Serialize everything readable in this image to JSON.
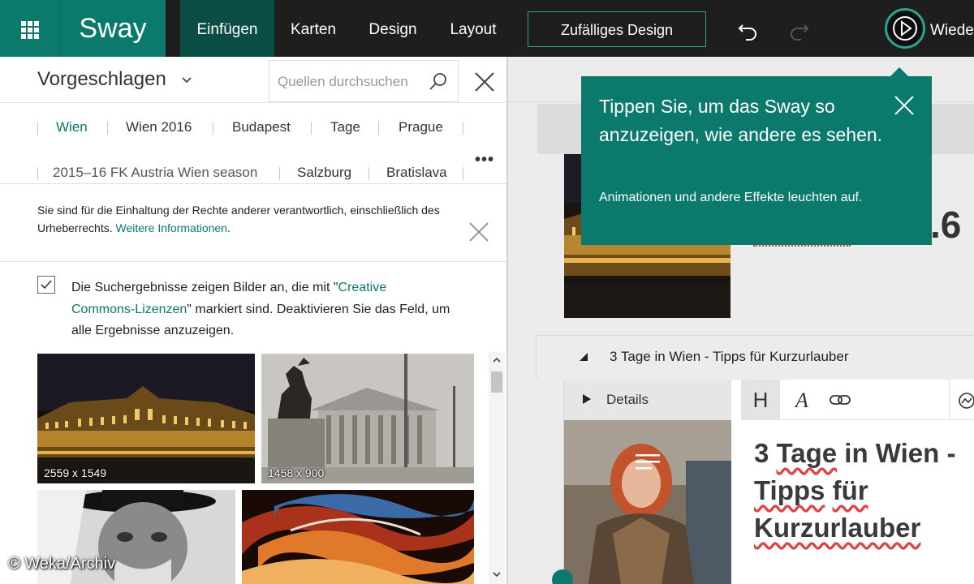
{
  "app": {
    "name": "Sway"
  },
  "colors": {
    "accent": "#0b7a6c",
    "topbar": "#1e1e1e",
    "active_tab": "#094d45",
    "link": "#0b7a6c",
    "spellcheck": "#dd4444"
  },
  "toolbar": {
    "tabs": [
      {
        "label": "Einfügen",
        "active": true
      },
      {
        "label": "Karten",
        "active": false
      },
      {
        "label": "Design",
        "active": false
      },
      {
        "label": "Layout",
        "active": false
      }
    ],
    "random_design_label": "Zufälliges Design",
    "undo_icon": "undo-icon",
    "redo_icon": "redo-icon",
    "play_icon": "play-icon",
    "replay_label": "Wiede"
  },
  "left_panel": {
    "source_label": "Vorgeschlagen",
    "search_placeholder": "Quellen durchsuchen",
    "chips_row1": [
      "Wien",
      "Wien 2016",
      "Budapest",
      "Tage",
      "Prague"
    ],
    "chips_row2": [
      "2015–16 FK Austria Wien season",
      "Salzburg",
      "Bratislava"
    ],
    "more_label": "•••",
    "rights_notice": {
      "text": "Sie sind für die Einhaltung der Rechte anderer verantwortlich, einschließlich des Urheberrechts. ",
      "link": "Weitere Informationen",
      "suffix": "."
    },
    "creative_commons": {
      "checked": true,
      "text_before": "Die Suchergebnisse zeigen Bilder an, die mit \"",
      "link": "Creative Commons-Lizenzen",
      "text_after": "\" markiert sind. Deaktivieren Sie das Feld, um alle Ergebnisse anzuzeigen."
    },
    "results": [
      {
        "dimensions": "2559 x 1549"
      },
      {
        "dimensions": "1458 x 900"
      },
      {
        "dimensions": ""
      },
      {
        "dimensions": ""
      }
    ]
  },
  "tooltip": {
    "title": "Tippen Sie, um das Sway so anzuzeigen, wie andere es sehen.",
    "body": "Animationen und andere Effekte leuchten auf."
  },
  "canvas": {
    "title_card_fragment": ".6",
    "section_title": "3 Tage in Wien - Tipps für Kurzurlauber",
    "details_label": "Details",
    "format_heading_label": "H",
    "format_emphasis_label": "A",
    "heading_words": [
      "3",
      "Tage",
      "in",
      "Wien",
      "-",
      "Tipps",
      "für",
      "Kurzurlauber"
    ]
  },
  "watermark": "© Weka/Archiv"
}
